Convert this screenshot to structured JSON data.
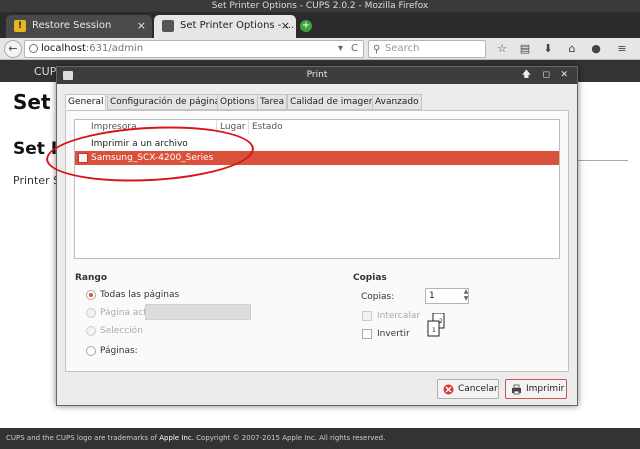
{
  "window": {
    "title": "Set Printer Options - CUPS 2.0.2 - Mozilla Firefox"
  },
  "tabs": [
    {
      "label": "Restore Session",
      "close": "×"
    },
    {
      "label": "Set Printer Options - ...",
      "close": "×"
    }
  ],
  "nav": {
    "url_host": "localhost",
    "url_path": ":631/admin",
    "reload": "C",
    "dropdown": "▾",
    "search_placeholder": "Search"
  },
  "page": {
    "cups_label": "CUP",
    "h1": "Set",
    "h2": "Set I",
    "text": "Printer S"
  },
  "footer": {
    "text_before": "CUPS and the CUPS logo are trademarks of ",
    "brand": "Apple Inc.",
    "text_after": " Copyright © 2007-2015 Apple Inc. All rights reserved."
  },
  "dialog": {
    "title": "Print",
    "tabs": [
      "General",
      "Configuración de página",
      "Options",
      "Tarea",
      "Calidad de imagen",
      "Avanzado"
    ],
    "printer_list": {
      "headers": [
        "Impresora",
        "Lugar",
        "Estado"
      ],
      "rows": [
        {
          "name": "Imprimir a un archivo",
          "selected": false
        },
        {
          "name": "Samsung_SCX-4200_Series",
          "selected": true
        }
      ]
    },
    "range": {
      "title": "Rango",
      "options": [
        {
          "label": "Todas las páginas",
          "state": "checked"
        },
        {
          "label": "Página actual",
          "state": "disabled"
        },
        {
          "label": "Selección",
          "state": "disabled"
        },
        {
          "label": "Páginas:",
          "state": "unchecked"
        }
      ]
    },
    "copies": {
      "title": "Copias",
      "label": "Copias:",
      "value": "1",
      "collate_label": "Intercalar",
      "reverse_label": "Invertir"
    },
    "buttons": {
      "cancel": "Cancelar",
      "print": "Imprimir"
    }
  },
  "colors": {
    "selection": "#d9513a",
    "annotation": "#d7141a"
  }
}
